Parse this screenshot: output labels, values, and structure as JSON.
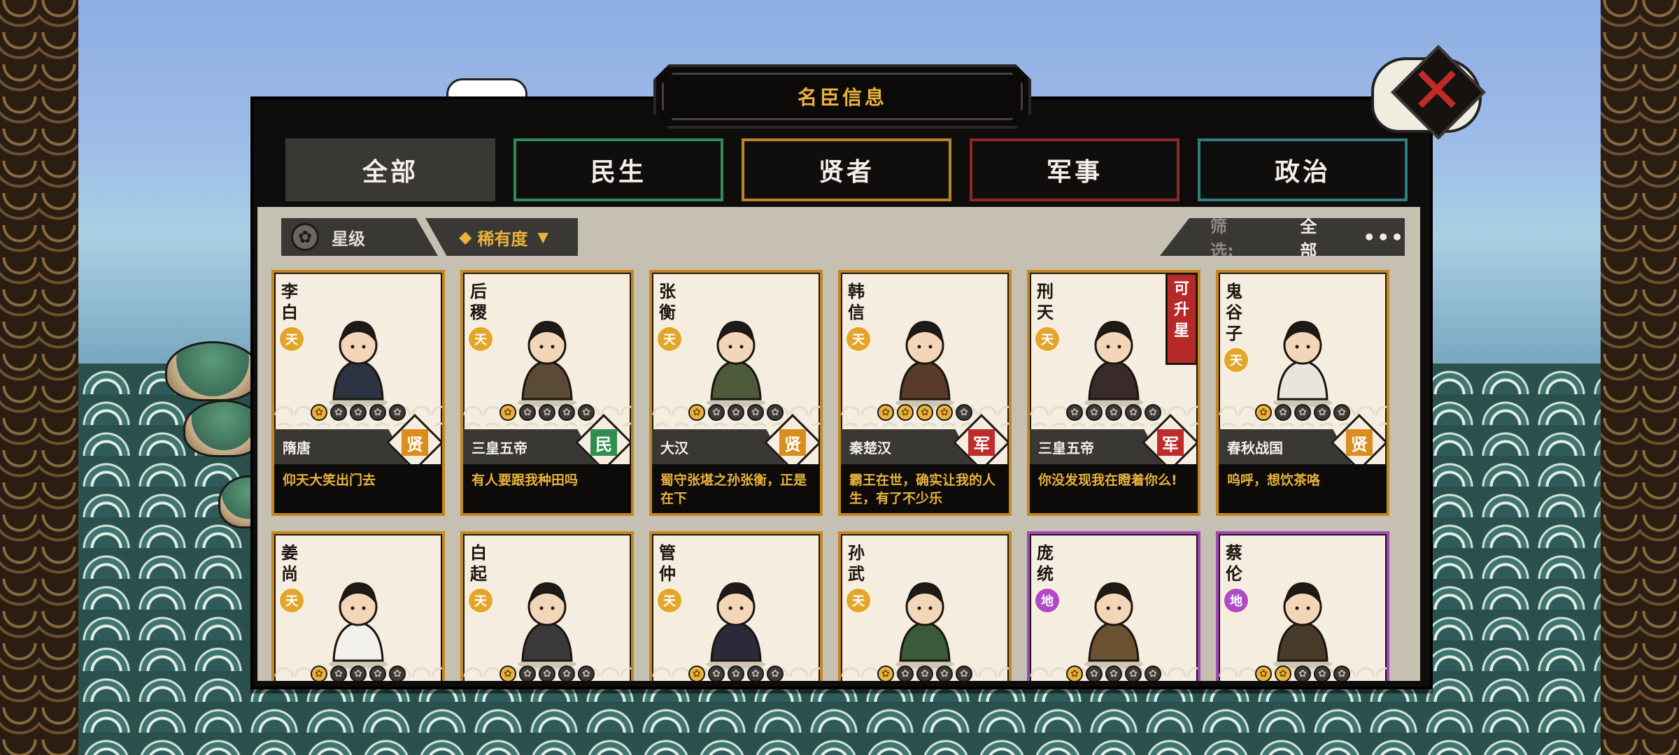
{
  "window": {
    "title": "名臣信息"
  },
  "tabs": [
    {
      "label": "全部",
      "color": "#3a3835"
    },
    {
      "label": "民生",
      "color": "#2f8c5a"
    },
    {
      "label": "贤者",
      "color": "#b8862a"
    },
    {
      "label": "军事",
      "color": "#8c2a2a"
    },
    {
      "label": "政治",
      "color": "#2f7d7e"
    }
  ],
  "sort": {
    "star_label": "星级",
    "rarity_label": "稀有度"
  },
  "filter": {
    "label": "筛选:",
    "value": "全部",
    "more": "•••"
  },
  "cards": [
    {
      "name": "李白",
      "grade": "天",
      "stars": 1,
      "dynasty": "隋唐",
      "category": "贤",
      "quote": "仰天大笑出门去"
    },
    {
      "name": "后稷",
      "grade": "天",
      "stars": 1,
      "dynasty": "三皇五帝",
      "category": "民",
      "quote": "有人要跟我种田吗"
    },
    {
      "name": "张衡",
      "grade": "天",
      "stars": 1,
      "dynasty": "大汉",
      "category": "贤",
      "quote": "蜀守张堪之孙张衡，正是在下"
    },
    {
      "name": "韩信",
      "grade": "天",
      "stars": 4,
      "dynasty": "秦楚汉",
      "category": "军",
      "quote": "霸王在世，确实让我的人生，有了不少乐"
    },
    {
      "name": "刑天",
      "grade": "天",
      "stars": 0,
      "dynasty": "三皇五帝",
      "category": "军",
      "quote": "你没发现我在瞪着你么!",
      "badge": "可升星"
    },
    {
      "name": "鬼谷子",
      "grade": "天",
      "stars": 1,
      "dynasty": "春秋战国",
      "category": "贤",
      "quote": "呜呼，想饮茶咯"
    },
    {
      "name": "姜尚",
      "grade": "天",
      "stars": 1
    },
    {
      "name": "白起",
      "grade": "天",
      "stars": 1
    },
    {
      "name": "管仲",
      "grade": "天",
      "stars": 1
    },
    {
      "name": "孙武",
      "grade": "天",
      "stars": 1
    },
    {
      "name": "庞统",
      "grade": "地",
      "stars": 1
    },
    {
      "name": "蔡伦",
      "grade": "地",
      "stars": 2
    }
  ],
  "colors": {
    "accent": "#e8b23c",
    "purple": "#a045b8",
    "gold_border": "#c5871e",
    "red": "#b52a29"
  }
}
